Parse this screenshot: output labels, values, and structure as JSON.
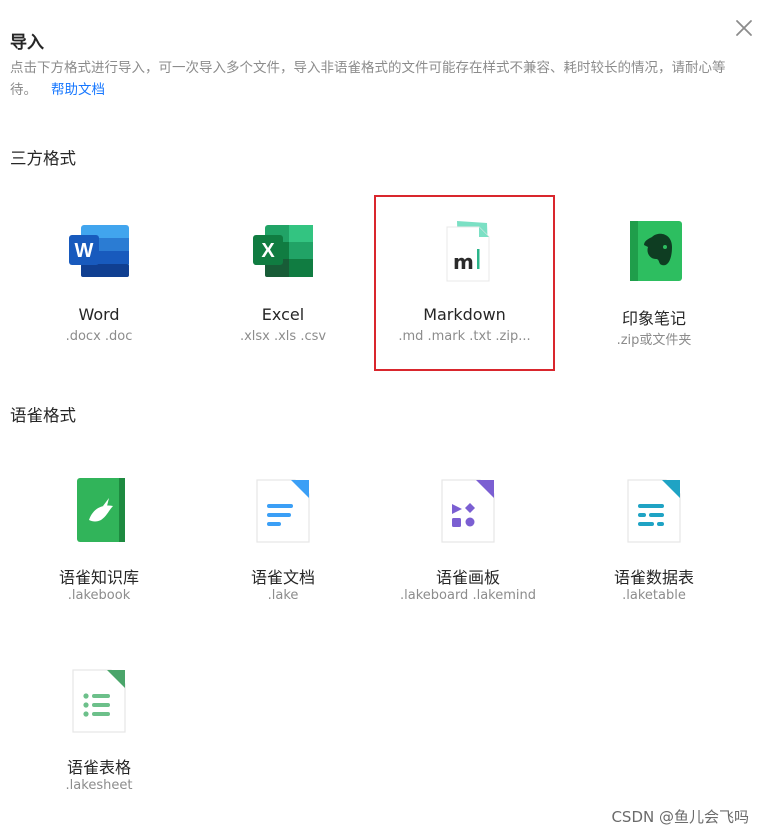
{
  "dialog": {
    "title": "导入",
    "description": "点击下方格式进行导入，可一次导入多个文件，导入非语雀格式的文件可能存在样式不兼容、耗时较长的情况，请耐心等待。",
    "help_link": "帮助文档",
    "close_icon": "close-icon"
  },
  "third_party": {
    "heading": "三方格式",
    "items": [
      {
        "name": "Word",
        "ext": ".docx .doc",
        "icon": "word-icon"
      },
      {
        "name": "Excel",
        "ext": ".xlsx .xls .csv",
        "icon": "excel-icon"
      },
      {
        "name": "Markdown",
        "ext": ".md .mark .txt .zip...",
        "icon": "markdown-icon",
        "highlighted": true
      },
      {
        "name": "印象笔记",
        "ext": ".zip或文件夹",
        "icon": "evernote-icon"
      }
    ]
  },
  "yuque": {
    "heading": "语雀格式",
    "items": [
      {
        "name": "语雀知识库",
        "ext": ".lakebook",
        "icon": "lakebook-icon"
      },
      {
        "name": "语雀文档",
        "ext": ".lake",
        "icon": "lake-doc-icon"
      },
      {
        "name": "语雀画板",
        "ext": ".lakeboard .lakemind",
        "icon": "lakeboard-icon"
      },
      {
        "name": "语雀数据表",
        "ext": ".laketable",
        "icon": "laketable-icon"
      },
      {
        "name": "语雀表格",
        "ext": ".lakesheet",
        "icon": "lakesheet-icon"
      }
    ]
  },
  "watermark": "CSDN @鱼儿会飞吗",
  "colors": {
    "highlight_border": "#d9262d",
    "link": "#1677ff",
    "word": "#2b7cd3",
    "excel": "#1f7244",
    "evernote": "#2dbe60",
    "lakebook": "#31b45a"
  }
}
